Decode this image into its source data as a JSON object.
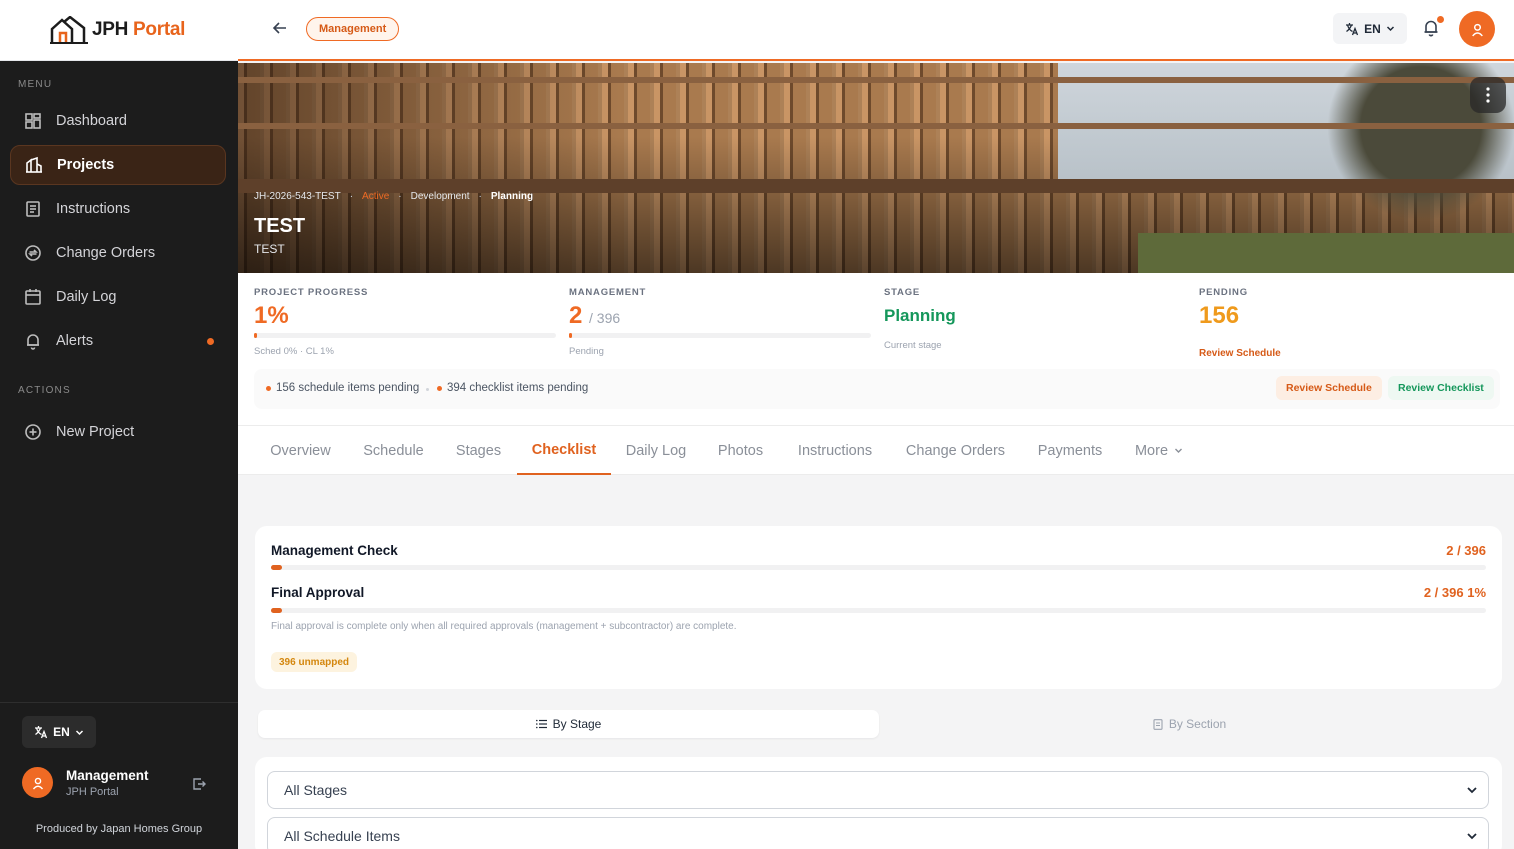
{
  "brand": {
    "name": "JPH",
    "name_accent": "Portal"
  },
  "colors": {
    "accent": "#ef6a24",
    "sidebar_bg": "#1c1c1c",
    "success": "#15975b",
    "amber": "#ef9a1c"
  },
  "sidebar": {
    "menu_heading": "MENU",
    "items": [
      {
        "label": "Dashboard",
        "icon": "dashboard-icon"
      },
      {
        "label": "Projects",
        "icon": "projects-icon",
        "active": true
      },
      {
        "label": "Instructions",
        "icon": "instructions-icon"
      },
      {
        "label": "Change Orders",
        "icon": "change-orders-icon"
      },
      {
        "label": "Daily Log",
        "icon": "calendar-icon"
      },
      {
        "label": "Alerts",
        "icon": "bell-icon",
        "badge": true
      }
    ],
    "actions_heading": "ACTIONS",
    "actions": [
      {
        "label": "New Project",
        "icon": "plus-circle-icon"
      }
    ],
    "language": "EN",
    "user": {
      "name": "Management",
      "org": "JPH Portal"
    },
    "produced_by": "Produced by Japan Homes Group"
  },
  "header": {
    "role_pill": "Management",
    "language": "EN"
  },
  "hero": {
    "project_code": "JH-2026-543-TEST",
    "status": "Active",
    "phase": "Development",
    "stage": "Planning",
    "title": "TEST",
    "subtitle": "TEST"
  },
  "stats": {
    "progress": {
      "label": "PROJECT PROGRESS",
      "value": "1%",
      "fraction": 0.01,
      "note": "Sched 0% · CL 1%"
    },
    "management": {
      "label": "MANAGEMENT",
      "value": "2",
      "total": "/ 396",
      "fraction": 0.005,
      "note": "Pending"
    },
    "stage": {
      "label": "STAGE",
      "value": "Planning",
      "note": "Current stage"
    },
    "pending": {
      "label": "PENDING",
      "value": "156",
      "link": "Review Schedule"
    }
  },
  "pending_strip": {
    "schedule": "156 schedule items pending",
    "checklist": "394 checklist items pending",
    "review_schedule": "Review Schedule",
    "review_checklist": "Review Checklist"
  },
  "tabs": [
    "Overview",
    "Schedule",
    "Stages",
    "Checklist",
    "Daily Log",
    "Photos",
    "Instructions",
    "Change Orders",
    "Payments",
    "More"
  ],
  "active_tab": "Checklist",
  "management_card": {
    "management_check": {
      "title": "Management Check",
      "value": "2 / 396"
    },
    "final_approval": {
      "title": "Final Approval",
      "value": "2 / 396 1%"
    },
    "note": "Final approval is complete only when all required approvals (management + subcontractor) are complete.",
    "unmapped": "396 unmapped"
  },
  "view_toggle": {
    "by_stage": "By Stage",
    "by_section": "By Section"
  },
  "filters": {
    "stage_select": "All Stages",
    "schedule_select": "All Schedule Items"
  }
}
